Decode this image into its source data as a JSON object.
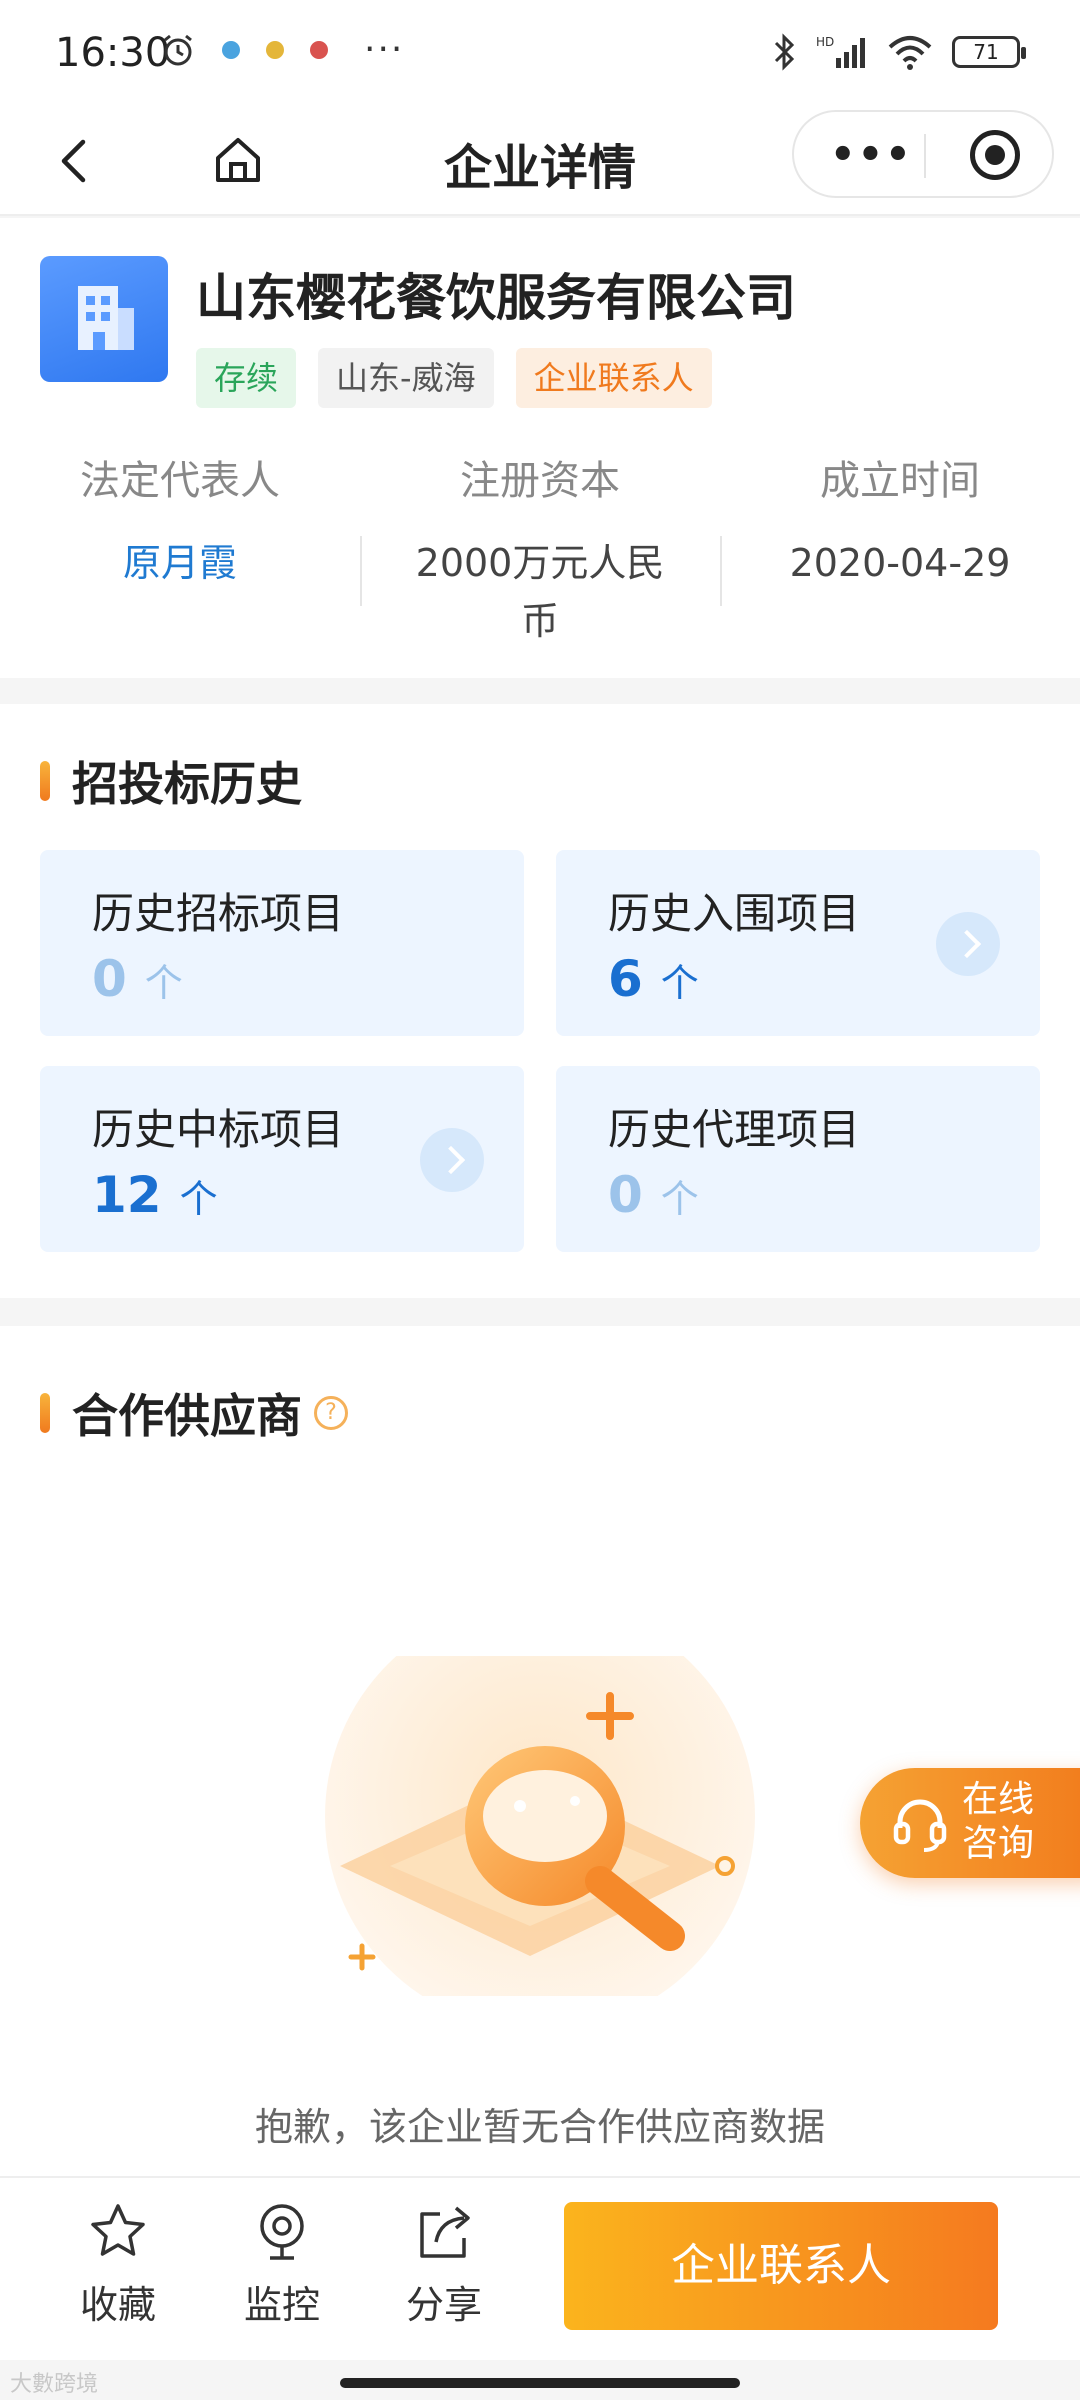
{
  "status_bar": {
    "time": "16:30",
    "battery": "71",
    "more": "···",
    "icons": [
      "alarm-icon",
      "app-notification-icon",
      "bluetooth-icon",
      "signal-icon",
      "wifi-icon",
      "battery-icon"
    ]
  },
  "navbar": {
    "title": "企业详情",
    "capsule_more": "•••"
  },
  "company": {
    "name": "山东樱花餐饮服务有限公司",
    "tags": [
      "存续",
      "山东-威海",
      "企业联系人"
    ],
    "info": [
      {
        "label": "法定代表人",
        "value": "原月霞"
      },
      {
        "label": "注册资本",
        "value": "2000万元人民币"
      },
      {
        "label": "成立时间",
        "value": "2020-04-29"
      }
    ]
  },
  "bidding": {
    "title": "招投标历史",
    "cards": [
      {
        "title": "历史招标项目",
        "count": "0",
        "unit": "个"
      },
      {
        "title": "历史入围项目",
        "count": "6",
        "unit": "个"
      },
      {
        "title": "历史中标项目",
        "count": "12",
        "unit": "个"
      },
      {
        "title": "历史代理项目",
        "count": "0",
        "unit": "个"
      }
    ]
  },
  "suppliers": {
    "title": "合作供应商",
    "help": "?",
    "empty_text": "抱歉，该企业暂无合作供应商数据"
  },
  "consult": {
    "label": "在线咨询"
  },
  "bottom_bar": {
    "favorite": "收藏",
    "monitor": "监控",
    "share": "分享",
    "cta": "企业联系人"
  },
  "watermark": "大數跨境",
  "colors": {
    "accent_blue": "#1f7ad1",
    "accent_orange": "#f57a1f",
    "tag_green": "#2aa55a"
  }
}
